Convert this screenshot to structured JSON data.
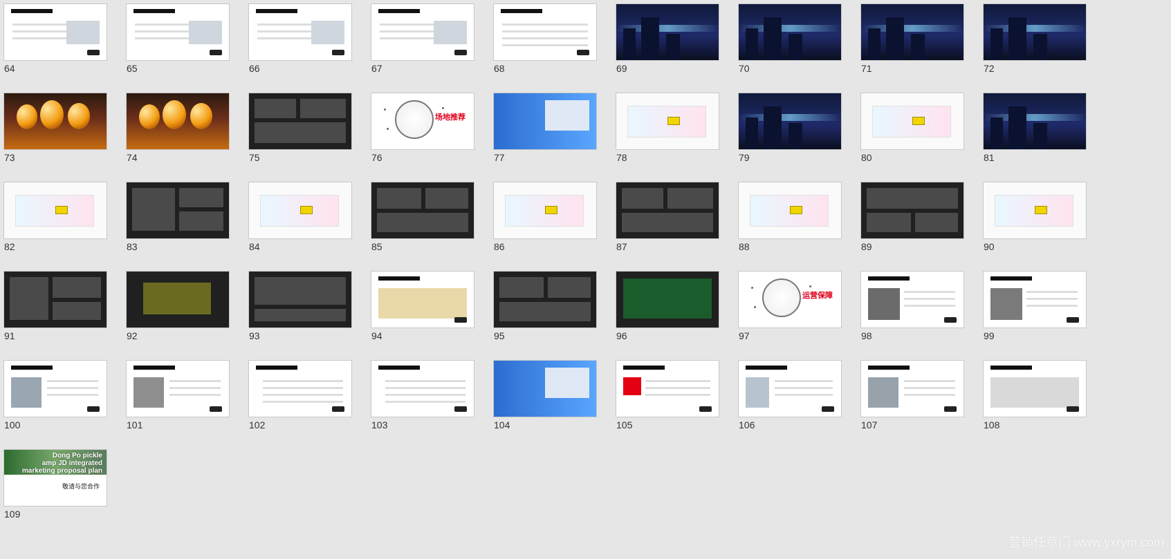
{
  "watermark": "营销任意门 www.yxrym.com",
  "thumbnails": [
    {
      "n": "64",
      "style": "white"
    },
    {
      "n": "65",
      "style": "white"
    },
    {
      "n": "66",
      "style": "white"
    },
    {
      "n": "67",
      "style": "white"
    },
    {
      "n": "68",
      "style": "white"
    },
    {
      "n": "69",
      "style": "night"
    },
    {
      "n": "70",
      "style": "night"
    },
    {
      "n": "71",
      "style": "night"
    },
    {
      "n": "72",
      "style": "night"
    },
    {
      "n": "73",
      "style": "gold"
    },
    {
      "n": "74",
      "style": "gold"
    },
    {
      "n": "75",
      "style": "dark"
    },
    {
      "n": "76",
      "style": "mono"
    },
    {
      "n": "77",
      "style": "blue"
    },
    {
      "n": "78",
      "style": "map"
    },
    {
      "n": "79",
      "style": "night"
    },
    {
      "n": "80",
      "style": "map"
    },
    {
      "n": "81",
      "style": "night"
    },
    {
      "n": "82",
      "style": "map"
    },
    {
      "n": "83",
      "style": "dark"
    },
    {
      "n": "84",
      "style": "map"
    },
    {
      "n": "85",
      "style": "dark"
    },
    {
      "n": "86",
      "style": "map"
    },
    {
      "n": "87",
      "style": "dark"
    },
    {
      "n": "88",
      "style": "map"
    },
    {
      "n": "89",
      "style": "dark"
    },
    {
      "n": "90",
      "style": "map"
    },
    {
      "n": "91",
      "style": "dark"
    },
    {
      "n": "92",
      "style": "dark"
    },
    {
      "n": "93",
      "style": "dark"
    },
    {
      "n": "94",
      "style": "white"
    },
    {
      "n": "95",
      "style": "dark"
    },
    {
      "n": "96",
      "style": "dark"
    },
    {
      "n": "97",
      "style": "mono"
    },
    {
      "n": "98",
      "style": "white"
    },
    {
      "n": "99",
      "style": "white"
    },
    {
      "n": "100",
      "style": "white"
    },
    {
      "n": "101",
      "style": "white"
    },
    {
      "n": "102",
      "style": "white"
    },
    {
      "n": "103",
      "style": "white"
    },
    {
      "n": "104",
      "style": "blue"
    },
    {
      "n": "105",
      "style": "white"
    },
    {
      "n": "106",
      "style": "white"
    },
    {
      "n": "107",
      "style": "white"
    },
    {
      "n": "108",
      "style": "white"
    },
    {
      "n": "109",
      "style": "last",
      "title_lines": [
        "Dong Po pickle",
        "amp JD integrated",
        "marketing proposal plan"
      ],
      "subtitle": "敬请与您合作"
    }
  ],
  "slide_text": {
    "t76": "场地推荐",
    "t97": "运营保障"
  }
}
